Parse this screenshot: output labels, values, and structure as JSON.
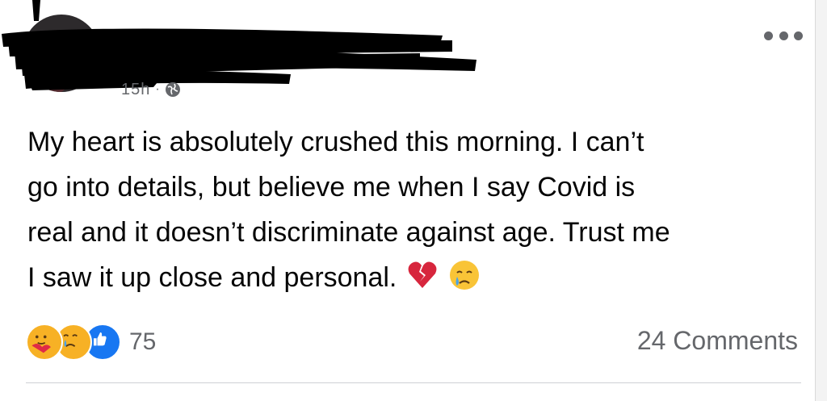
{
  "post": {
    "timestamp": "15h",
    "separator": "·",
    "privacy_icon": "globe-icon",
    "more_icon": "more-horizontal-icon",
    "text_lines": [
      "My heart is absolutely crushed this morning. I can’t",
      "go into details, but believe me when I say Covid is",
      "real and it doesn’t discriminate against age. Trust me",
      "I saw it up close and personal."
    ],
    "emojis": [
      "broken-heart-icon",
      "crying-face-icon"
    ]
  },
  "reactions": {
    "icons": [
      "care-reaction-icon",
      "sad-reaction-icon",
      "like-reaction-icon"
    ],
    "count": "75"
  },
  "comments": {
    "label": "24 Comments"
  },
  "colors": {
    "text": "#050505",
    "secondary": "#65676b",
    "like_blue": "#1877f2",
    "reaction_yellow": "#f7b125",
    "broken_heart": "#d7263d"
  }
}
